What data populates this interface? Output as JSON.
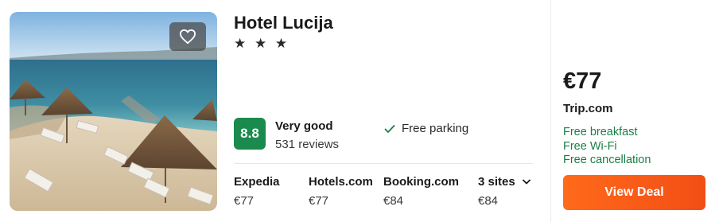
{
  "hotel": {
    "name": "Hotel Lucija",
    "stars": "★ ★ ★",
    "star_count": 3
  },
  "rating": {
    "score": "8.8",
    "label": "Very good",
    "reviews": "531 reviews",
    "badge_color": "#1a8a4e"
  },
  "amenity": {
    "label": "Free parking",
    "icon": "check-icon"
  },
  "sites": [
    {
      "name": "Expedia",
      "price": "€77"
    },
    {
      "name": "Hotels.com",
      "price": "€77"
    },
    {
      "name": "Booking.com",
      "price": "€84"
    },
    {
      "name": "3 sites",
      "price": "€84",
      "icon": "chevron-down-icon"
    }
  ],
  "deal": {
    "price": "€77",
    "provider": "Trip.com",
    "perks": [
      "Free breakfast",
      "Free Wi-Fi",
      "Free cancellation"
    ],
    "perk_color": "#1a7f45",
    "button_label": "View Deal",
    "button_color": "#f75b17"
  },
  "favorite": {
    "icon": "heart-icon"
  }
}
